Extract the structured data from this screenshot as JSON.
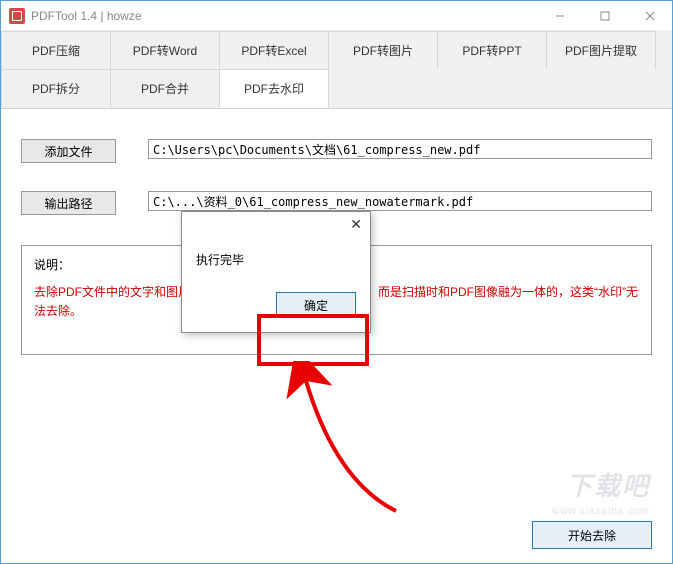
{
  "window": {
    "title": "PDFTool 1.4  |   howze"
  },
  "tabs": {
    "row1": [
      "PDF压缩",
      "PDF转Word",
      "PDF转Excel",
      "PDF转图片",
      "PDF转PPT",
      "PDF图片提取"
    ],
    "row2": [
      "PDF拆分",
      "PDF合并",
      "PDF去水印"
    ],
    "active": "PDF去水印"
  },
  "form": {
    "add_file_btn": "添加文件",
    "file_path": "C:\\Users\\pc\\Documents\\文档\\61_compress_new.pdf",
    "output_btn": "输出路径",
    "output_path_prefix": "C:\\",
    "output_path_suffix": "\\资料_0\\61_compress_new_nowatermark.pdf"
  },
  "dialog": {
    "message": "执行完毕",
    "ok_label": "确定"
  },
  "description": {
    "title": "说明：",
    "text": "去除PDF文件中的文字和图片水印，有些“水印”并非真正的水印，而是扫描时和PDF图像融为一体的，这类“水印”无法去除。"
  },
  "footer": {
    "start_btn": "开始去除"
  },
  "watermark": {
    "main": "下载吧",
    "sub": "www.xiazaiba.com"
  }
}
